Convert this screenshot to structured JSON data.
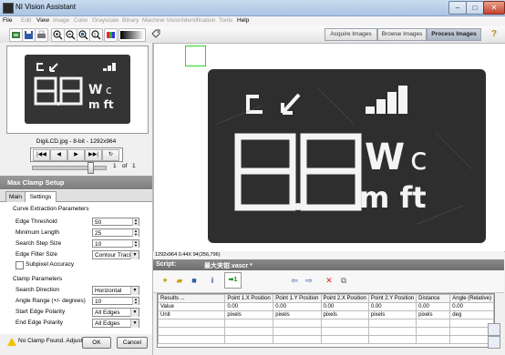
{
  "window": {
    "title": "NI Vision Assistant",
    "btn_min": "–",
    "btn_max": "□",
    "btn_close": "✕"
  },
  "menu": [
    {
      "label": "File",
      "enabled": true
    },
    {
      "label": "Edit",
      "enabled": false
    },
    {
      "label": "View",
      "enabled": true
    },
    {
      "label": "Image",
      "enabled": false
    },
    {
      "label": "Color",
      "enabled": false
    },
    {
      "label": "Grayscale",
      "enabled": false
    },
    {
      "label": "Binary",
      "enabled": false
    },
    {
      "label": "Machine Vision",
      "enabled": false
    },
    {
      "label": "Identification",
      "enabled": false
    },
    {
      "label": "Tools",
      "enabled": false
    },
    {
      "label": "Help",
      "enabled": true
    }
  ],
  "toolbar": {
    "icons": [
      "acquire-icon",
      "save-icon",
      "print-icon",
      "zoom-in-icon",
      "zoom-out-icon",
      "zoom-fit-icon",
      "zoom-actual-icon",
      "palette-icon",
      "gradient-icon",
      "tag-icon"
    ],
    "tabs": [
      "Acquire Images",
      "Browse Images",
      "Process Images"
    ],
    "active_tab": "Process Images",
    "help": "?"
  },
  "thumbnail": {
    "caption": "DigiLCD.jpg - 8-bit - 1292x964",
    "nav_buttons": [
      "|◀◀",
      "◀",
      "▶",
      "▶▶|",
      "↻"
    ],
    "page": "1",
    "of_label": "of",
    "total": "1"
  },
  "step_panel": {
    "title": "Max Clamp Setup",
    "tabs": [
      "Main",
      "Settings"
    ],
    "active_tab": "Settings",
    "curve_section": "Curve Extraction Parameters",
    "edge_threshold_label": "Edge Threshold",
    "edge_threshold": "50",
    "min_length_label": "Minimum Length",
    "min_length": "25",
    "search_step_label": "Search Step Size",
    "search_step": "10",
    "edge_filter_label": "Edge Filter Size",
    "edge_filter": "Contour Tracing",
    "subpixel_label": "Subpixel Accuracy",
    "clamp_section": "Clamp Parameters",
    "search_dir_label": "Search Direction",
    "search_dir": "Horizontal",
    "angle_range_label": "Angle Range (+/- degrees)",
    "angle_range": "10",
    "start_pol_label": "Start Edge Polarity",
    "start_pol": "All Edges",
    "end_pol_label": "End Edge Polarity",
    "end_pol": "All Edges",
    "warning": "No Clamp Found.  Adjust Settings",
    "ok": "OK",
    "cancel": "Cancel"
  },
  "status": {
    "image_info": "1292x964 0.44X 94",
    "coords": "(256,796)"
  },
  "script": {
    "label": "Script:",
    "name": "最大夹钳.vascr *",
    "step_count": "1"
  },
  "results": {
    "headers": [
      "Results ...",
      "Point 1.X Position",
      "Point 1.Y Position",
      "Point 2.X Position",
      "Point 2.Y Position",
      "Distance",
      "Angle (Relative)"
    ],
    "rows": [
      [
        "Value",
        "0.00",
        "0.00",
        "0.00",
        "0.00",
        "0.00",
        "0.00"
      ],
      [
        "Unit",
        "pixels",
        "pixels",
        "pixels",
        "pixels",
        "pixels",
        "deg"
      ]
    ]
  },
  "lcd": {
    "top_left": "ㄴ",
    "arrow": "↙",
    "digits": "8.8",
    "unit_top": "W",
    "unit_moon": "☾",
    "unit_bottom": "m ft"
  },
  "colors": {
    "accent": "#aac4e3",
    "step_header": "#8a8a8a",
    "lcd_bg": "#2e2e2e",
    "lcd_fg": "#f4f4f4",
    "roi": "#2bd52b"
  }
}
